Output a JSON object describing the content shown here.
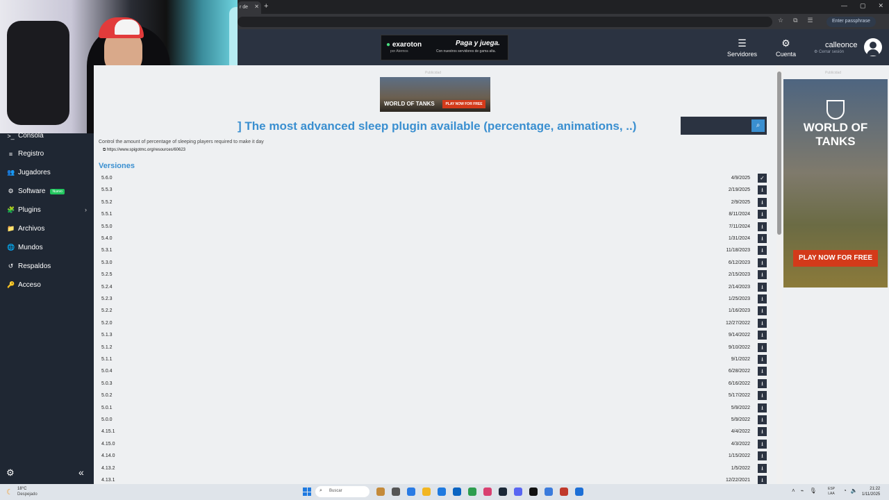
{
  "browser": {
    "tab_title": "r de",
    "tab_close": "✕",
    "new_tab": "+",
    "window_controls": [
      "—",
      "▢",
      "✕"
    ],
    "toolbar_icons": [
      "☆",
      "⧉",
      "☰"
    ],
    "passphrase_label": "Enter passphrase"
  },
  "header": {
    "ad": {
      "brand": "exaroton",
      "brand_sub": "por Aternos",
      "title": "Paga y juega.",
      "subtitle": "Con nuestros servidores de gama alta."
    },
    "servers_label": "Servidores",
    "account_label": "Cuenta",
    "username": "calleonce",
    "logout_label": "Cerrar sesión"
  },
  "sidebar": {
    "items": [
      {
        "label": "Consola",
        "icon": "terminal-icon",
        "glyph": ">_"
      },
      {
        "label": "Registro",
        "icon": "log-icon",
        "glyph": "≡"
      },
      {
        "label": "Jugadores",
        "icon": "players-icon",
        "glyph": "👥"
      },
      {
        "label": "Software",
        "icon": "software-icon",
        "glyph": "⚙"
      },
      {
        "label": "Plugins",
        "icon": "puzzle-icon",
        "glyph": "🧩"
      },
      {
        "label": "Archivos",
        "icon": "folder-icon",
        "glyph": "📁"
      },
      {
        "label": "Mundos",
        "icon": "globe-icon",
        "glyph": "🌐"
      },
      {
        "label": "Respaldos",
        "icon": "backup-icon",
        "glyph": "↺"
      },
      {
        "label": "Acceso",
        "icon": "key-icon",
        "glyph": "🔑"
      }
    ],
    "software_badge": "Nuevo",
    "settings_glyph": "⚙",
    "collapse_glyph": "«"
  },
  "ads": {
    "label": "Publicidad",
    "wot_logo": "WORLD OF TANKS",
    "wot_small_logo": "WORLD OF TANKS",
    "wot_cta_small": "PLAY NOW FOR FREE",
    "wot_cta_big": "PLAY NOW FOR FREE"
  },
  "plugin": {
    "title": "] The most advanced sleep plugin available (percentage, animations, ..)",
    "description": "Control the amount of percentage of sleeping players required to make it day",
    "link": "https://www.spigotmc.org/resources/60623",
    "versions_heading": "Versiones",
    "versions": [
      {
        "version": "5.6.0",
        "date": "4/9/2025",
        "installed": true
      },
      {
        "version": "5.5.3",
        "date": "2/19/2025",
        "installed": false
      },
      {
        "version": "5.5.2",
        "date": "2/9/2025",
        "installed": false
      },
      {
        "version": "5.5.1",
        "date": "8/11/2024",
        "installed": false
      },
      {
        "version": "5.5.0",
        "date": "7/11/2024",
        "installed": false
      },
      {
        "version": "5.4.0",
        "date": "1/31/2024",
        "installed": false
      },
      {
        "version": "5.3.1",
        "date": "11/18/2023",
        "installed": false
      },
      {
        "version": "5.3.0",
        "date": "6/12/2023",
        "installed": false
      },
      {
        "version": "5.2.5",
        "date": "2/15/2023",
        "installed": false
      },
      {
        "version": "5.2.4",
        "date": "2/14/2023",
        "installed": false
      },
      {
        "version": "5.2.3",
        "date": "1/25/2023",
        "installed": false
      },
      {
        "version": "5.2.2",
        "date": "1/16/2023",
        "installed": false
      },
      {
        "version": "5.2.0",
        "date": "12/27/2022",
        "installed": false
      },
      {
        "version": "5.1.3",
        "date": "9/14/2022",
        "installed": false
      },
      {
        "version": "5.1.2",
        "date": "9/10/2022",
        "installed": false
      },
      {
        "version": "5.1.1",
        "date": "9/1/2022",
        "installed": false
      },
      {
        "version": "5.0.4",
        "date": "6/28/2022",
        "installed": false
      },
      {
        "version": "5.0.3",
        "date": "6/16/2022",
        "installed": false
      },
      {
        "version": "5.0.2",
        "date": "5/17/2022",
        "installed": false
      },
      {
        "version": "5.0.1",
        "date": "5/9/2022",
        "installed": false
      },
      {
        "version": "5.0.0",
        "date": "5/9/2022",
        "installed": false
      },
      {
        "version": "4.15.1",
        "date": "4/4/2022",
        "installed": false
      },
      {
        "version": "4.15.0",
        "date": "4/3/2022",
        "installed": false
      },
      {
        "version": "4.14.0",
        "date": "1/15/2022",
        "installed": false
      },
      {
        "version": "4.13.2",
        "date": "1/5/2022",
        "installed": false
      },
      {
        "version": "4.13.1",
        "date": "12/22/2021",
        "installed": false
      }
    ]
  },
  "taskbar": {
    "weather_temp": "18°C",
    "weather_cond": "Despejado",
    "search_placeholder": "Buscar",
    "app_colors": [
      "#c48a3a",
      "#555555",
      "#2a7be4",
      "#f2b622",
      "#1f7ae0",
      "#0a64c2",
      "#2e9e4f",
      "#d94070",
      "#1b2838",
      "#5865f2",
      "#111111",
      "#3b7bdc",
      "#c0392b",
      "#1d6fd6"
    ],
    "lang_top": "ESP",
    "lang_bottom": "LAA",
    "time": "21:22",
    "date": "1/11/2025"
  }
}
